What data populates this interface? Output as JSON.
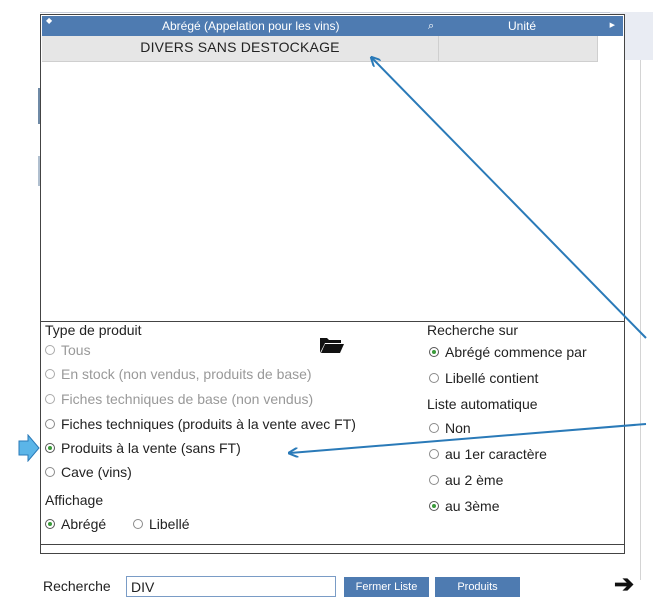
{
  "grid": {
    "col_abrege": "Abrégé (Appelation pour les vins)",
    "col_unite": "Unité",
    "rows": [
      {
        "abrege": "DIVERS  SANS DESTOCKAGE",
        "unite": ""
      }
    ]
  },
  "type_produit": {
    "title": "Type de produit",
    "options": [
      {
        "label": "Tous",
        "selected": false,
        "enabled": false
      },
      {
        "label": "En stock (non vendus, produits de base)",
        "selected": false,
        "enabled": false
      },
      {
        "label": "Fiches techniques de base (non vendus)",
        "selected": false,
        "enabled": false
      },
      {
        "label": "Fiches techniques (produits à la vente avec FT)",
        "selected": false,
        "enabled": true
      },
      {
        "label": "Produits à la vente (sans FT)",
        "selected": true,
        "enabled": true
      },
      {
        "label": "Cave (vins)",
        "selected": false,
        "enabled": true
      }
    ]
  },
  "affichage": {
    "title": "Affichage",
    "options": [
      {
        "label": "Abrégé",
        "selected": true
      },
      {
        "label": "Libellé",
        "selected": false
      }
    ]
  },
  "recherche_sur": {
    "title": "Recherche sur",
    "options": [
      {
        "label": "Abrégé commence par",
        "selected": true
      },
      {
        "label": "Libellé contient",
        "selected": false
      }
    ]
  },
  "liste_auto": {
    "title": "Liste automatique",
    "options": [
      {
        "label": "Non",
        "selected": false
      },
      {
        "label": "au 1er caractère",
        "selected": false
      },
      {
        "label": "au 2 ème",
        "selected": false
      },
      {
        "label": "au 3ème",
        "selected": true
      }
    ]
  },
  "search": {
    "label": "Recherche",
    "value": "DIV",
    "fermer_label": "Fermer Liste",
    "produits_label": "Produits"
  },
  "icons": {
    "folder": "folder-icon",
    "search": "search-icon",
    "next": "arrow-right-icon"
  },
  "colors": {
    "header": "#4e7bb1",
    "annotation": "#2a7ab8",
    "radio_selected": "#3a9a3a"
  }
}
